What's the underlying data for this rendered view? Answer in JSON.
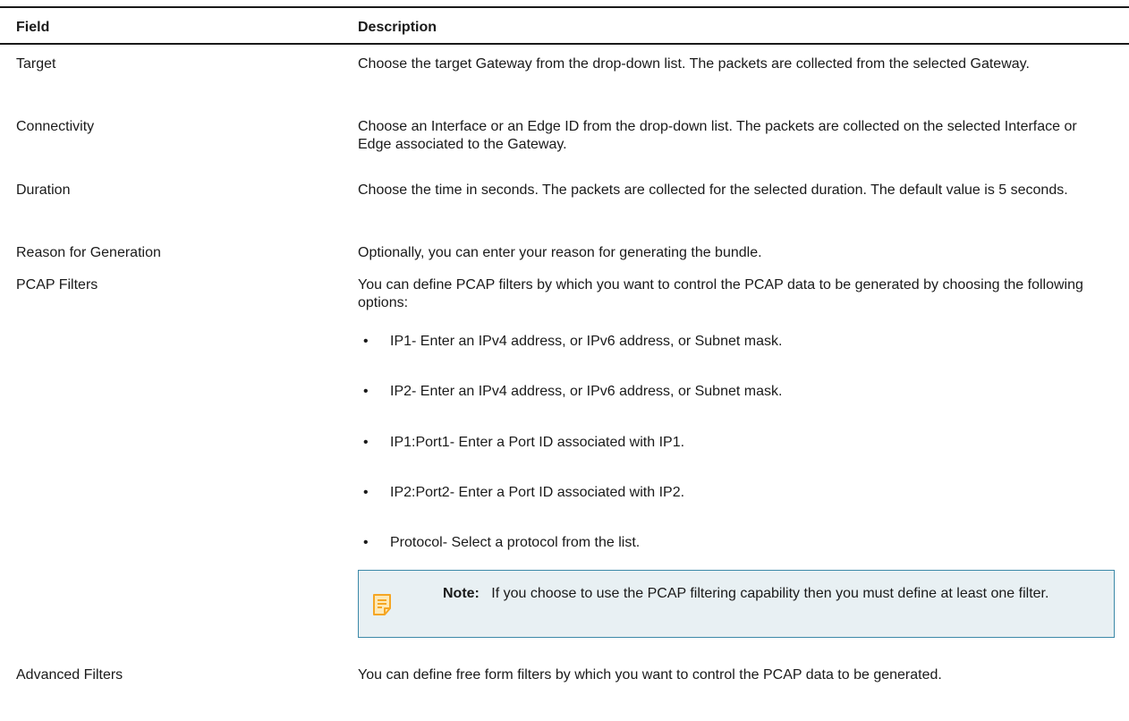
{
  "table": {
    "headers": {
      "field": "Field",
      "description": "Description"
    },
    "rows": [
      {
        "field": "Target",
        "description": "Choose the target Gateway from the drop-down list. The packets are collected from the selected Gateway."
      },
      {
        "field": "Connectivity",
        "description": "Choose an Interface or an Edge ID from the drop-down list. The packets are collected on the selected Interface or Edge associated to the Gateway."
      },
      {
        "field": "Duration",
        "description": "Choose the time in seconds. The packets are collected for the selected duration. The default value is 5 seconds."
      },
      {
        "field": "Reason for Generation",
        "description": "Optionally, you can enter your reason for generating the bundle."
      },
      {
        "field": "PCAP Filters",
        "description": "You can define PCAP filters by which you want to control the PCAP data to be generated by choosing the following options:",
        "bullets": [
          "IP1- Enter an IPv4 address, or IPv6 address, or Subnet mask.",
          "IP2- Enter an IPv4 address, or IPv6 address, or Subnet mask.",
          "IP1:Port1- Enter a Port ID associated with IP1.",
          "IP2:Port2- Enter a Port ID associated with IP2.",
          "Protocol- Select a protocol from the list."
        ],
        "note": {
          "label": "Note:",
          "text": "If you choose to use the PCAP filtering capability then you must define at least one filter.",
          "icon": "note-icon",
          "icon_color": "#f5a623",
          "border_color": "#3c89a8",
          "background_color": "#e8f0f3"
        }
      },
      {
        "field": "Advanced Filters",
        "description": "You can define free form filters by which you want to control the PCAP data to be generated."
      }
    ]
  }
}
